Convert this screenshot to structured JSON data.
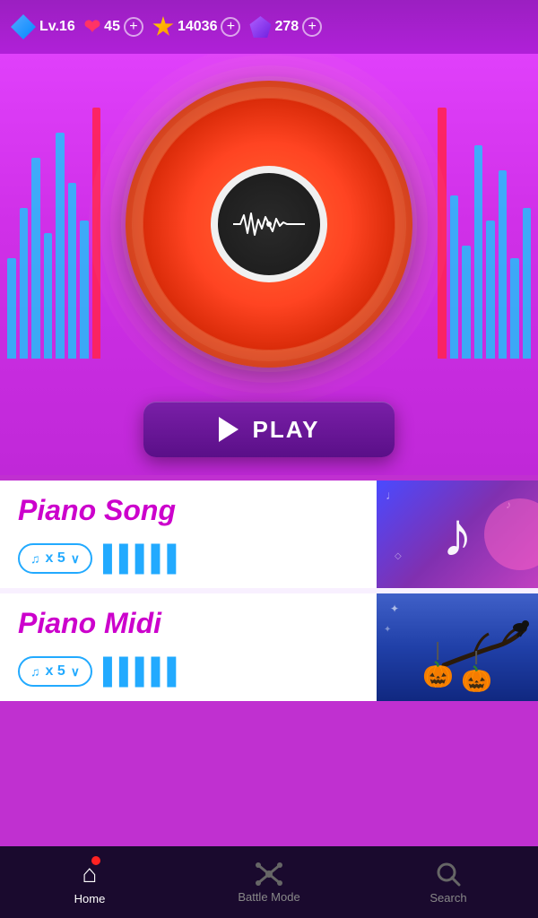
{
  "topbar": {
    "level_label": "Lv.16",
    "hearts": "45",
    "coins": "14036",
    "gems": "278",
    "plus": "+"
  },
  "play_btn": {
    "label": "PLAY"
  },
  "cards": [
    {
      "title": "Piano Song",
      "count": "x 5",
      "type": "piano_song"
    },
    {
      "title": "Piano Midi",
      "count": "x 5",
      "type": "piano_midi"
    }
  ],
  "nav": {
    "home": "Home",
    "battle": "Battle Mode",
    "search": "Search"
  },
  "eq_colors": {
    "left": "#00ccff",
    "right": "#ff3366"
  }
}
